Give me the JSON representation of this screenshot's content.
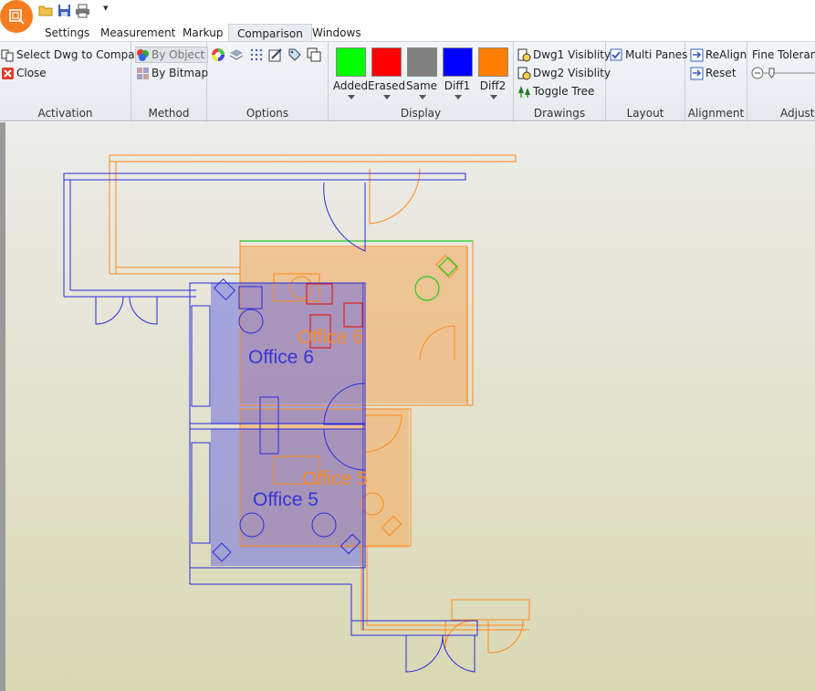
{
  "qat": {
    "more_glyph": "▾",
    "icons": [
      "open-folder-icon",
      "save-icon",
      "print-icon"
    ]
  },
  "tabs": [
    {
      "label": "Settings",
      "active": false
    },
    {
      "label": "Measurement",
      "active": false
    },
    {
      "label": "Markup",
      "active": false
    },
    {
      "label": "Comparison",
      "active": true
    },
    {
      "label": "Windows",
      "active": false
    }
  ],
  "ribbon": {
    "activation": {
      "label": "Activation",
      "select": "Select Dwg to Compare",
      "close": "Close"
    },
    "method": {
      "label": "Method",
      "by_object": "By Object",
      "by_bitmap": "By Bitmap"
    },
    "options": {
      "label": "Options"
    },
    "display": {
      "label": "Display",
      "items": [
        {
          "label": "Added",
          "color": "#00ff00"
        },
        {
          "label": "Erased",
          "color": "#ff0000"
        },
        {
          "label": "Same",
          "color": "#808080"
        },
        {
          "label": "Diff1",
          "color": "#0000ff"
        },
        {
          "label": "Diff2",
          "color": "#ff8000"
        }
      ]
    },
    "drawings": {
      "label": "Drawings",
      "dwg1": "Dwg1 Visiblity",
      "dwg2": "Dwg2 Visiblity",
      "toggle": "Toggle Tree"
    },
    "layout": {
      "label": "Layout",
      "multi_panes": "Multi Panes",
      "multi_panes_checked": true
    },
    "alignment": {
      "label": "Alignment",
      "realign": "ReAlign",
      "reset": "Reset"
    },
    "adjust": {
      "label": "Adjustr",
      "fine_tolerance": "Fine Tolerance"
    }
  },
  "drawing": {
    "dwg1_color": "#2b2bd8",
    "dwg2_color": "#ff8a1a",
    "added_color": "#22cc22",
    "erased_color": "#e02020",
    "labels": [
      {
        "text": "Office 6",
        "drawing": "dwg1"
      },
      {
        "text": "Office 6",
        "drawing": "dwg2"
      },
      {
        "text": "Office 5",
        "drawing": "dwg1"
      },
      {
        "text": "Office 5",
        "drawing": "dwg2"
      }
    ]
  }
}
